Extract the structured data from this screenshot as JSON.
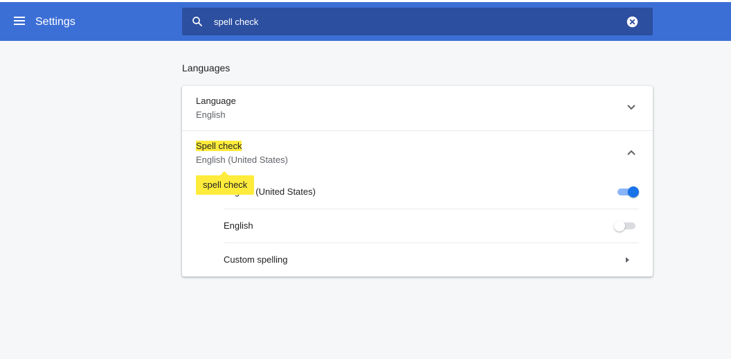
{
  "header": {
    "title": "Settings",
    "menu_icon": "hamburger-menu-icon",
    "brand_color": "#3c6fd6"
  },
  "search": {
    "value": "spell check",
    "search_icon": "search-icon",
    "clear_icon": "clear-circle-icon"
  },
  "section": {
    "title": "Languages"
  },
  "language_row": {
    "label": "Language",
    "value": "English",
    "expand_icon": "chevron-down-icon"
  },
  "spellcheck_row": {
    "label": "Spell check",
    "value": "English (United States)",
    "collapse_icon": "chevron-up-icon",
    "highlight_color": "#ffeb3b"
  },
  "spellcheck_items": [
    {
      "label": "English (United States)",
      "enabled": true
    },
    {
      "label": "English",
      "enabled": false
    }
  ],
  "custom_spelling": {
    "label": "Custom spelling",
    "arrow_icon": "arrow-right-icon"
  },
  "search_bubble": {
    "text": "spell check"
  },
  "colors": {
    "toggle_on": "#1a73e8",
    "toggle_track_on": "#8ab4f8",
    "toggle_off_track": "#dadce0"
  }
}
